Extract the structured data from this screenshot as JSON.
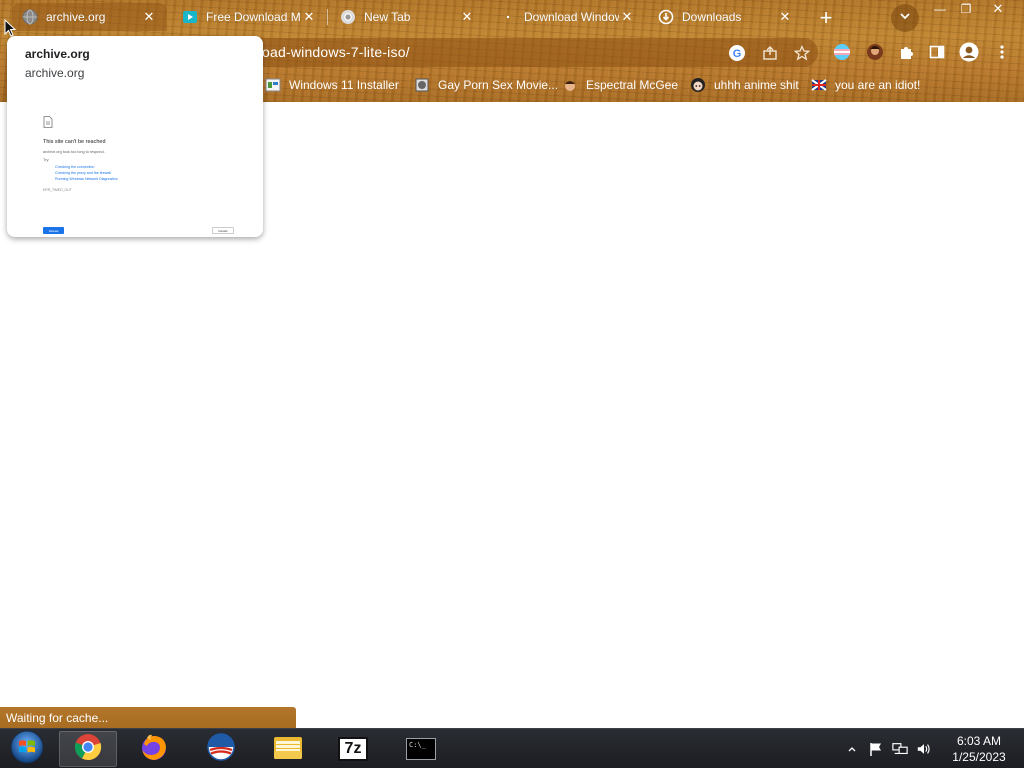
{
  "window": {
    "minimize_glyph": "—",
    "restore_glyph": "❐",
    "close_glyph": "✕"
  },
  "tabs": [
    {
      "title": "archive.org",
      "icon": "globe-icon",
      "active": true
    },
    {
      "title": "Free Download Ma",
      "icon": "video-icon",
      "active": false
    },
    {
      "title": "New Tab",
      "icon": "chrome-icon",
      "active": false
    },
    {
      "title": "Download Window",
      "icon": "loading-icon",
      "active": false
    },
    {
      "title": "Downloads",
      "icon": "download-icon",
      "active": false
    }
  ],
  "tab_close_glyph": "✕",
  "new_tab_glyph": "+",
  "omnibox": {
    "url": "oad-windows-7-lite-iso/"
  },
  "bookmarks": [
    {
      "label": "Windows 11 Installer",
      "icon": "installer-icon"
    },
    {
      "label": "Gay Porn Sex Movie...",
      "icon": "globe-bookmark-icon"
    },
    {
      "label": "Espectral McGee",
      "icon": "face-icon"
    },
    {
      "label": "uhhh anime shit",
      "icon": "anime-icon"
    },
    {
      "label": "you are an idiot!",
      "icon": "flag-icon"
    }
  ],
  "hover_card": {
    "title": "archive.org",
    "domain": "archive.org",
    "preview": {
      "heading": "This site can't be reached",
      "line1": "archive.org took too long to respond.",
      "try_label": "Try:",
      "suggestions": [
        "Checking the connection",
        "Checking the proxy and the firewall",
        "Running Windows Network Diagnostics"
      ],
      "error_code": "ERR_TIMED_OUT",
      "reload_label": "Reload",
      "details_label": "Details"
    }
  },
  "status": {
    "text": "Waiting for cache..."
  },
  "taskbar": {
    "items": [
      {
        "name": "start-button",
        "icon": "windows-start-icon"
      },
      {
        "name": "chrome",
        "icon": "chrome-icon"
      },
      {
        "name": "firefox",
        "icon": "firefox-icon"
      },
      {
        "name": "opera",
        "icon": "opera-icon"
      },
      {
        "name": "file-explorer",
        "icon": "folder-icon"
      },
      {
        "name": "7zip",
        "icon": "7zip-icon"
      },
      {
        "name": "command-prompt",
        "icon": "terminal-icon"
      }
    ],
    "sevenzip_label": "7z",
    "cmd_label": "C:\\_",
    "clock": {
      "time": "6:03 AM",
      "date": "1/25/2023"
    }
  },
  "colors": {
    "chrome_wood": "#b9782a",
    "taskbar": "#1b1d22",
    "link_blue": "#1a73e8"
  }
}
